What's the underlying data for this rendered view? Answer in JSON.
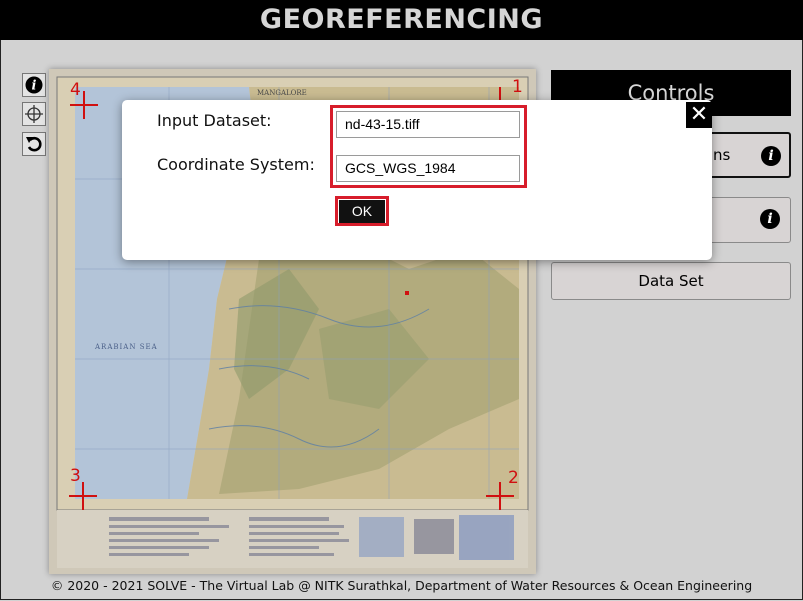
{
  "header": {
    "title": "GEOREFERENCING"
  },
  "toolbar": {
    "buttons": [
      {
        "icon": "info-icon"
      },
      {
        "icon": "crosshair-icon"
      },
      {
        "icon": "undo-icon"
      }
    ]
  },
  "map": {
    "corner_labels": [
      "1",
      "2",
      "3",
      "4"
    ],
    "top_caption": "MANGALORE",
    "sea_label": "ARABIAN SEA",
    "marker_color": "#d01010"
  },
  "controls": {
    "title": "Controls",
    "instructions_partial": "ns",
    "dataset_button": "Data Set"
  },
  "modal": {
    "input_dataset_label": "Input Dataset:",
    "input_dataset_value": "nd-43-15.tiff",
    "coord_system_label": "Coordinate System:",
    "coord_system_value": "GCS_WGS_1984",
    "ok_label": "OK",
    "close_symbol": "✕",
    "highlight_color": "#d71d2b"
  },
  "footer": {
    "text": "© 2020 - 2021 SOLVE - The Virtual Lab @ NITK Surathkal, Department of Water Resources & Ocean Engineering"
  }
}
